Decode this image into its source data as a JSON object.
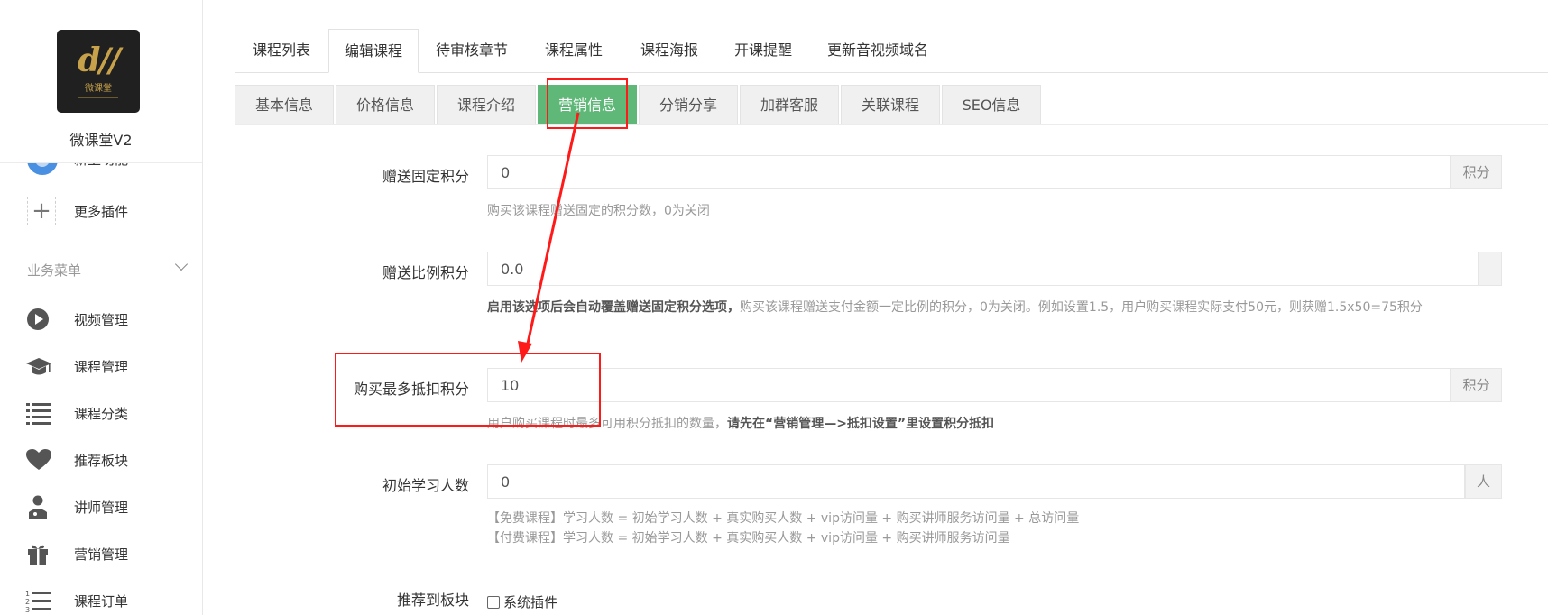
{
  "sidebar": {
    "brand_name": "微课堂V2",
    "logo_text": "微课堂",
    "partial_item": "新上功能",
    "more_plugins": "更多插件",
    "section_title": "业务菜单",
    "items": [
      {
        "label": "视频管理",
        "icon": "play-icon"
      },
      {
        "label": "课程管理",
        "icon": "graduation-cap-icon"
      },
      {
        "label": "课程分类",
        "icon": "list-icon"
      },
      {
        "label": "推荐板块",
        "icon": "heart-icon"
      },
      {
        "label": "讲师管理",
        "icon": "teacher-icon"
      },
      {
        "label": "营销管理",
        "icon": "gift-icon"
      },
      {
        "label": "课程订单",
        "icon": "ordered-list-icon"
      }
    ]
  },
  "top_tabs": [
    "课程列表",
    "编辑课程",
    "待审核章节",
    "课程属性",
    "课程海报",
    "开课提醒",
    "更新音视频域名"
  ],
  "top_tab_active": "编辑课程",
  "sub_tabs": [
    "基本信息",
    "价格信息",
    "课程介绍",
    "营销信息",
    "分销分享",
    "加群客服",
    "关联课程",
    "SEO信息"
  ],
  "sub_tab_active": "营销信息",
  "form": {
    "fixed_points": {
      "label": "赠送固定积分",
      "value": "0",
      "addon": "积分",
      "hint": "购买该课程赠送固定的积分数，0为关闭"
    },
    "ratio_points": {
      "label": "赠送比例积分",
      "value": "0.0",
      "hint_bold": "启用该选项后会自动覆盖赠送固定积分选项，",
      "hint": "购买该课程赠送支付金额一定比例的积分，0为关闭。例如设置1.5，用户购买课程实际支付50元，则获赠1.5x50=75积分"
    },
    "max_deduct": {
      "label": "购买最多抵扣积分",
      "value": "10",
      "addon": "积分",
      "hint": "用户购买课程时最多可用积分抵扣的数量，",
      "hint_bold": "请先在“营销管理—>抵扣设置”里设置积分抵扣"
    },
    "initial_learners": {
      "label": "初始学习人数",
      "value": "0",
      "addon": "人",
      "hint_free": "【免费课程】学习人数 = 初始学习人数 + 真实购买人数 + vip访问量 + 购买讲师服务访问量 + 总访问量",
      "hint_paid": "【付费课程】学习人数 = 初始学习人数 + 真实购买人数 + vip访问量 + 购买讲师服务访问量"
    },
    "recommend": {
      "label": "推荐到板块",
      "option": "系统插件"
    }
  },
  "colors": {
    "active_tab": "#5fb878",
    "annotation": "#ff1a1a"
  }
}
